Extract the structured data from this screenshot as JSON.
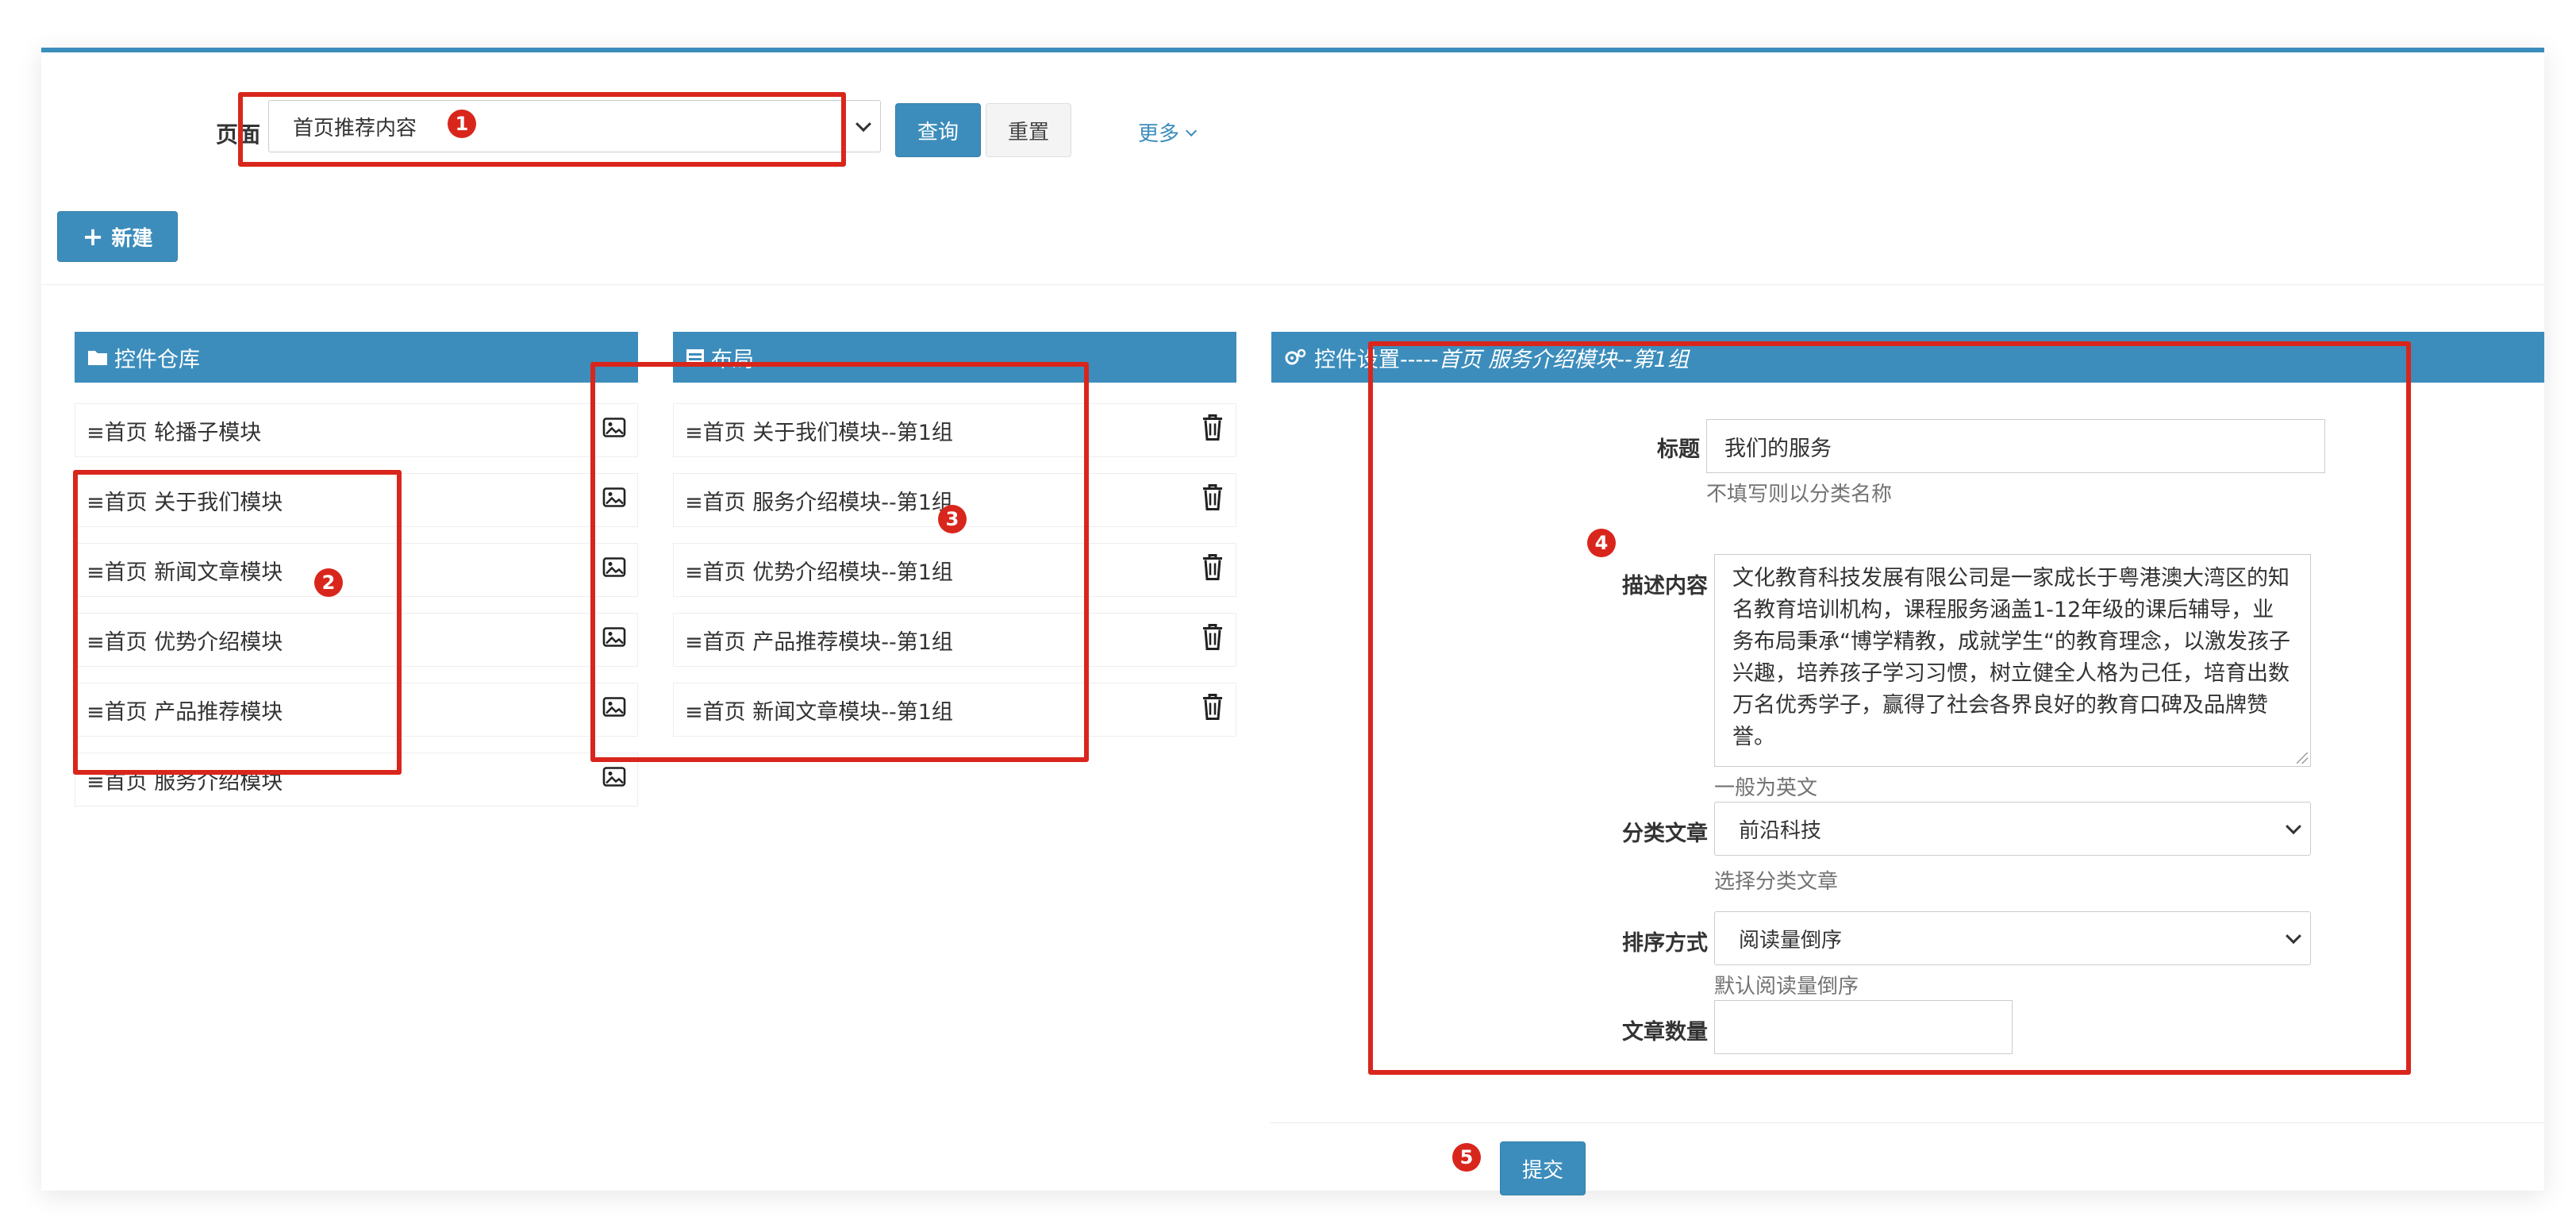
{
  "search": {
    "page_label": "页面",
    "page_value": "首页推荐内容",
    "query_label": "查询",
    "reset_label": "重置",
    "more_label": "更多"
  },
  "toolbar": {
    "new_label": "新建",
    "new_icon": "+"
  },
  "warehouse": {
    "title": "控件仓库",
    "items": [
      {
        "label": "≡首页 轮播子模块"
      },
      {
        "label": "≡首页 关于我们模块"
      },
      {
        "label": "≡首页 新闻文章模块"
      },
      {
        "label": "≡首页 优势介绍模块"
      },
      {
        "label": "≡首页 产品推荐模块"
      },
      {
        "label": "≡首页 服务介绍模块"
      }
    ]
  },
  "layout": {
    "title": "布局",
    "items": [
      {
        "label": "≡首页 关于我们模块--第1组"
      },
      {
        "label": "≡首页 服务介绍模块--第1组"
      },
      {
        "label": "≡首页 优势介绍模块--第1组"
      },
      {
        "label": "≡首页 产品推荐模块--第1组"
      },
      {
        "label": "≡首页 新闻文章模块--第1组"
      }
    ]
  },
  "settings": {
    "title_prefix": "控件设置-----",
    "title_context": "首页 服务介绍模块--第1组",
    "fields": {
      "title_label": "标题",
      "title_value": "我们的服务",
      "title_help": "不填写则以分类名称",
      "desc_label": "描述内容",
      "desc_value": "文化教育科技发展有限公司是一家成长于粤港澳大湾区的知名教育培训机构，课程服务涵盖1-12年级的课后辅导，业务布局秉承“博学精教，成就学生“的教育理念，以激发孩子兴趣，培养孩子学习习惯，树立健全人格为己任，培育出数万名优秀学子，赢得了社会各界良好的教育口碑及品牌赞誉。",
      "desc_help": "一般为英文",
      "category_label": "分类文章",
      "category_value": "前沿科技",
      "category_help": "选择分类文章",
      "sort_label": "排序方式",
      "sort_value": "阅读量倒序",
      "sort_help": "默认阅读量倒序",
      "count_label": "文章数量",
      "count_value": ""
    }
  },
  "submit_label": "提交",
  "badges": [
    "1",
    "2",
    "3",
    "4",
    "5"
  ],
  "colors": {
    "primary": "#3c8dbc",
    "annotation": "#d9261c"
  }
}
